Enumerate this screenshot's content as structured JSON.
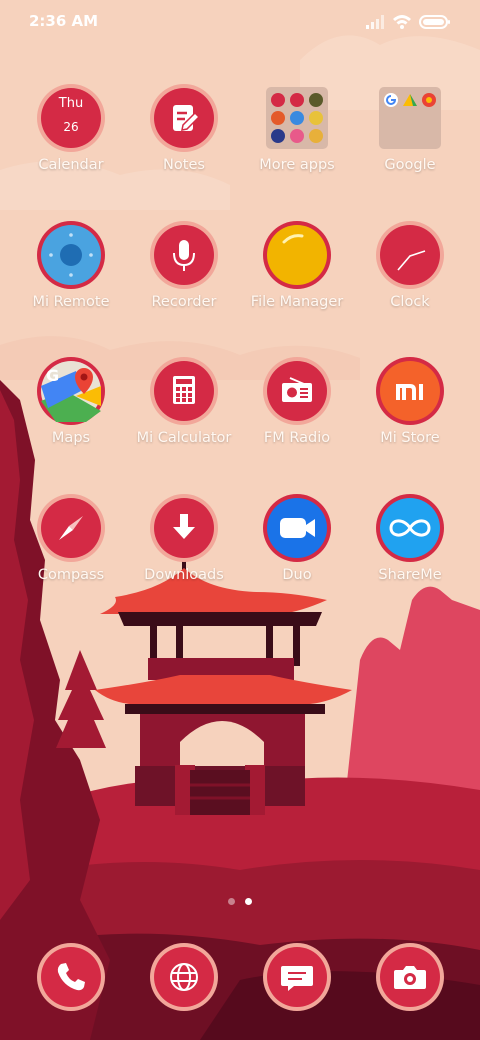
{
  "status_bar": {
    "time": "2:36 AM"
  },
  "calendar": {
    "day": "Thu",
    "date": "26"
  },
  "apps": [
    {
      "label": "Calendar",
      "icon": "calendar-icon"
    },
    {
      "label": "Notes",
      "icon": "notes-icon"
    },
    {
      "label": "More apps",
      "icon": "folder-icon"
    },
    {
      "label": "Google",
      "icon": "folder-icon"
    },
    {
      "label": "Mi Remote",
      "icon": "remote-icon"
    },
    {
      "label": "Recorder",
      "icon": "microphone-icon"
    },
    {
      "label": "File Manager",
      "icon": "file-manager-icon"
    },
    {
      "label": "Clock",
      "icon": "clock-icon"
    },
    {
      "label": "Maps",
      "icon": "maps-icon"
    },
    {
      "label": "Mi Calculator",
      "icon": "calculator-icon"
    },
    {
      "label": "FM Radio",
      "icon": "radio-icon"
    },
    {
      "label": "Mi Store",
      "icon": "mi-store-icon"
    },
    {
      "label": "Compass",
      "icon": "compass-icon"
    },
    {
      "label": "Downloads",
      "icon": "download-icon"
    },
    {
      "label": "Duo",
      "icon": "video-camera-icon"
    },
    {
      "label": "ShareMe",
      "icon": "share-icon"
    }
  ],
  "dock": [
    {
      "name": "phone",
      "icon": "phone-icon"
    },
    {
      "name": "browser",
      "icon": "globe-icon"
    },
    {
      "name": "messages",
      "icon": "message-icon"
    },
    {
      "name": "camera",
      "icon": "camera-icon"
    }
  ],
  "pages": {
    "count": 2,
    "current": 2
  },
  "colors": {
    "icon_red": "#d42a45",
    "icon_ring": "#f2a79a",
    "sky": "#f6d2bd",
    "label": "#fff8f2"
  }
}
